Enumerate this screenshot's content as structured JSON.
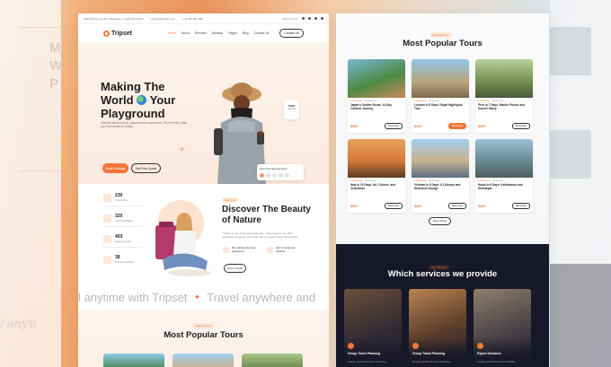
{
  "left_page": {
    "topbar": {
      "address": "3891 Ranchview Dr, Richardson, California 62639",
      "email": "contact@tripset.com",
      "phone": "(+1) 256 256 999",
      "follow_label": "Follow Us On"
    },
    "nav": {
      "brand": "Tripset",
      "links": [
        "Home",
        "About",
        "Services",
        "Booking",
        "Pages",
        "Blog",
        "Contact Us"
      ],
      "cta": "Contact Us"
    },
    "hero": {
      "title_line1": "Making The",
      "title_line2a": "World",
      "title_line2b": "Your",
      "title_line3": "Playground",
      "description": "Ultimate travel hub for unique travel experiences. We're here to take you from dream to reality.",
      "primary_button": "Book Package",
      "secondary_button": "Get Free Quote",
      "badge_value": "100%",
      "badge_label": "Satisfied",
      "experience_label": "How Your Experience?"
    },
    "stats": [
      {
        "value": "239",
        "label": "Tours Done"
      },
      {
        "value": "320",
        "label": "New Destination"
      },
      {
        "value": "403",
        "label": "Happy Guides"
      },
      {
        "value": "38",
        "label": "Premium Resorts"
      }
    ],
    "about": {
      "pill": "About Us",
      "title": "Discover The Beauty of Nature",
      "description": "Tripset is one of the best agencies. Travel agents use their expertise to explore the world and to create unique adventures.",
      "features": [
        "Be Guiding the best guarantee",
        "24/7 emergency helpline"
      ],
      "button": "Get In Touch"
    },
    "marquee": {
      "text1": "l anytime with Tripset",
      "text2": "Travel anywhere and"
    },
    "tours": {
      "pill": "Featured Tour",
      "title": "Most Popular Tours"
    }
  },
  "right_page": {
    "tours_pill": "Featured Tour",
    "tours_title": "Most Popular Tours",
    "tours": [
      {
        "title": "Japan's Golden Route: 14-Day Cultural Journey",
        "price": "$599",
        "rating": "4.8 Reviews",
        "reviews": "(3) Reviews",
        "button": "Book Now"
      },
      {
        "title": "London in 5 Days: Royal Highlights Tour",
        "price": "$219",
        "rating": "4.8 Reviews",
        "reviews": "(3) Reviews",
        "button": "Book Now"
      },
      {
        "title": "Peru in 7 Days: Machu Picchu and Sacred Valley",
        "price": "$499",
        "rating": "4.8 Reviews",
        "reviews": "(3) Reviews",
        "button": "Book Now"
      },
      {
        "title": "Italy in 10 Days: Art, Cuisine, and Coastlines",
        "price": "$557",
        "rating": "4.8 Reviews",
        "reviews": "(3) Reviews",
        "button": "Book Now"
      },
      {
        "title": "Vietnam in 8 Days: A Culinary and Historical Voyage",
        "price": "$269",
        "rating": "4.8 Reviews",
        "reviews": "(3) Reviews",
        "button": "Book Now"
      },
      {
        "title": "Nepal in 6 Days: Kathmandu and Himalayas",
        "price": "$499",
        "rating": "4.8 Reviews",
        "reviews": "(3) Reviews",
        "button": "Book Now"
      }
    ],
    "more_button": "More Listings",
    "services_pill": "Our Services",
    "services_title": "Which services we provide",
    "services": [
      {
        "name": "Group Travel Planning",
        "description": "Arrange tours and itineraries for families"
      },
      {
        "name": "Group Travel Planning",
        "description": "Arrange tours and itineraries for families"
      },
      {
        "name": "Expert Guidance",
        "description": "Arrange tours and itineraries for families"
      }
    ]
  },
  "colors": {
    "accent": "#f0773a",
    "dark": "#161728"
  }
}
